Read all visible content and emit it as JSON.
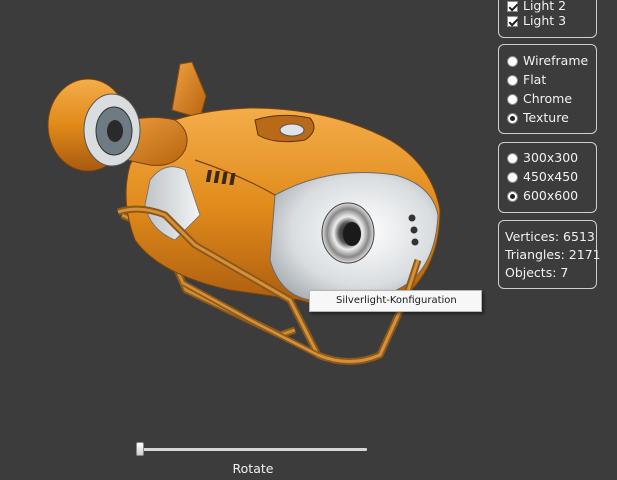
{
  "lights": [
    {
      "label": "Light 2",
      "checked": true
    },
    {
      "label": "Light 3",
      "checked": true
    }
  ],
  "render_modes": {
    "options": [
      "Wireframe",
      "Flat",
      "Chrome",
      "Texture"
    ],
    "selected": "Texture"
  },
  "resolutions": {
    "options": [
      "300x300",
      "450x450",
      "600x600"
    ],
    "selected": "600x600"
  },
  "stats": {
    "vertices": "Vertices: 6513",
    "triangles": "Triangles: 2171",
    "objects": "Objects: 7"
  },
  "context_menu": {
    "item": "Silverlight-Konfiguration"
  },
  "slider": {
    "label": "Rotate",
    "value": 0.0
  },
  "colors": {
    "background": "#3c3c3c",
    "model_orange": "#e8901c",
    "model_white": "#e6e6e6"
  }
}
